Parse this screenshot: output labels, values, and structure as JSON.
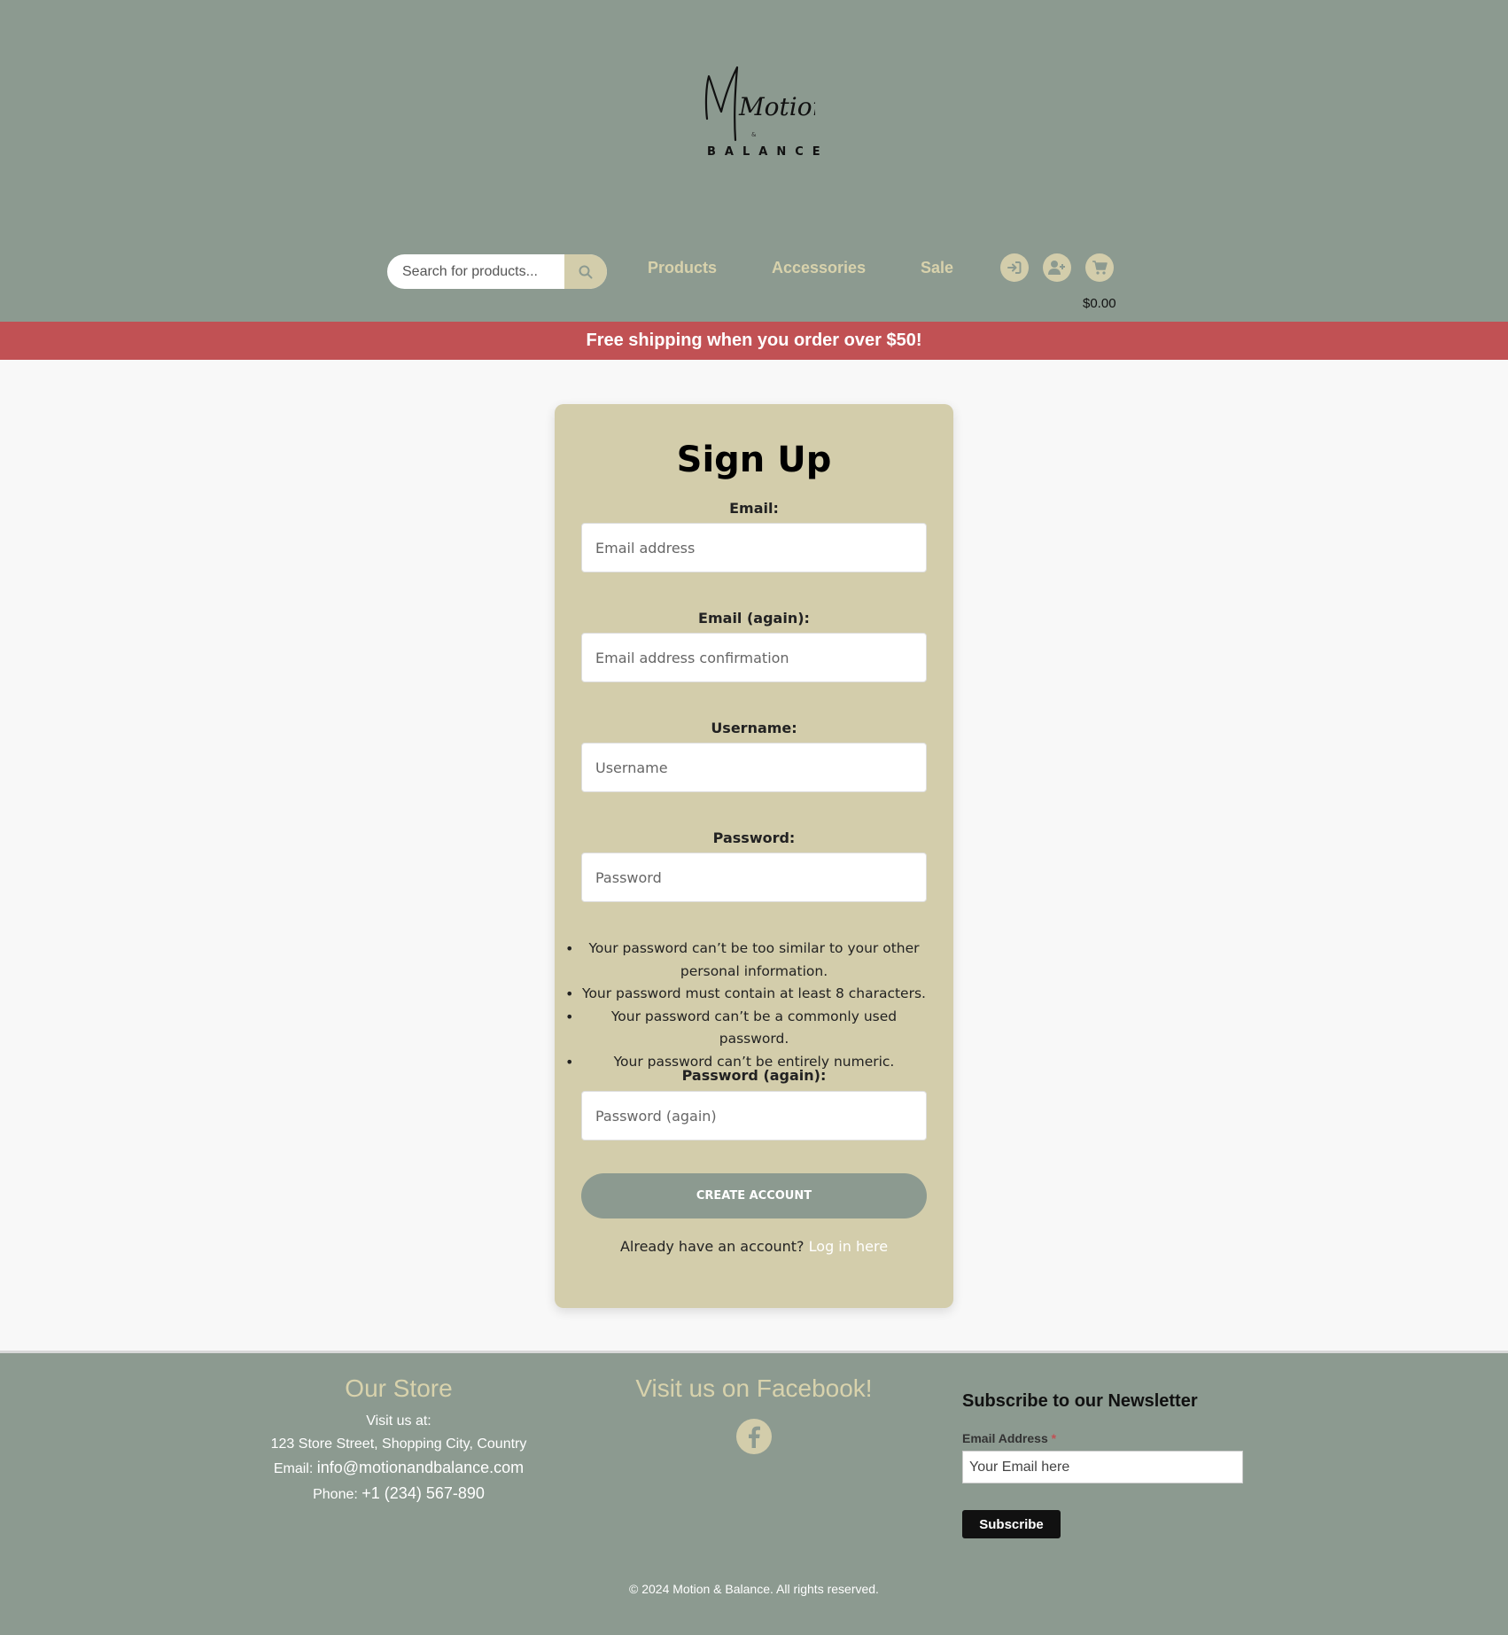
{
  "brand": {
    "logo_script": "Motion",
    "logo_amp": "&",
    "logo_sub": "BALANCE"
  },
  "header": {
    "search_placeholder": "Search for products...",
    "nav": [
      "Products",
      "Accessories",
      "Sale"
    ],
    "cart_total": "$0.00",
    "icons": [
      "login-icon",
      "add-user-icon",
      "cart-icon"
    ]
  },
  "promo": {
    "text": "Free shipping when you order over $50!"
  },
  "signup": {
    "title": "Sign Up",
    "email_label": "Email:",
    "email_placeholder": "Email address",
    "email2_label": "Email (again):",
    "email2_placeholder": "Email address confirmation",
    "username_label": "Username:",
    "username_placeholder": "Username",
    "password_label": "Password:",
    "password_placeholder": "Password",
    "password_rules": [
      "Your password can’t be too similar to your other personal information.",
      "Your password must contain at least 8 characters.",
      "Your password can’t be a commonly used password.",
      "Your password can’t be entirely numeric."
    ],
    "password2_label": "Password (again):",
    "password2_placeholder": "Password (again)",
    "submit_label": "CREATE ACCOUNT",
    "login_prompt": "Already have an account?",
    "login_link": "Log in here"
  },
  "footer": {
    "store_heading": "Our Store",
    "visit_label": "Visit us at:",
    "address": "123 Store Street, Shopping City, Country",
    "email_prefix": "Email:",
    "email": "info@motionandbalance.com",
    "phone_prefix": "Phone:",
    "phone": "+1 (234) 567-890",
    "facebook_heading": "Visit us on Facebook!",
    "newsletter_title": "Subscribe to our Newsletter",
    "newsletter_label": "Email Address",
    "newsletter_required": "*",
    "newsletter_placeholder": "Your Email here",
    "subscribe_label": "Subscribe",
    "copyright": "© 2024 Motion & Balance. All rights reserved."
  },
  "colors": {
    "header_bg": "#8c9a90",
    "accent_tan": "#d3cdab",
    "promo_red": "#c15154",
    "page_bg": "#f8f8f8"
  }
}
